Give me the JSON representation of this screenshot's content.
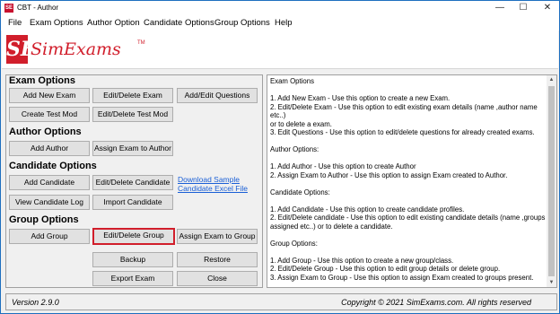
{
  "window": {
    "title": "CBT - Author",
    "minimize": "—",
    "maximize": "☐",
    "close": "✕"
  },
  "menu": [
    "File",
    "Exam Options",
    "Author Option",
    "Candidate Options",
    "Group Options",
    "Help"
  ],
  "logo": {
    "mark": "SE",
    "text": "SimExams",
    "tm": "TM"
  },
  "sections": {
    "exam": {
      "title": "Exam Options",
      "add_new_exam": "Add New Exam",
      "edit_delete_exam": "Edit/Delete Exam",
      "add_edit_questions": "Add/Edit Questions",
      "create_test_mod": "Create Test Mod",
      "edit_delete_test_mod": "Edit/Delete Test Mod"
    },
    "author": {
      "title": "Author Options",
      "add_author": "Add Author",
      "assign_exam_to_author": "Assign Exam to Author"
    },
    "candidate": {
      "title": "Candidate Options",
      "add_candidate": "Add Candidate",
      "edit_delete_candidate": "Edit/Delete Candidate",
      "download_link_1": "Download Sample",
      "download_link_2": "Candidate Excel File",
      "view_candidate_log": "View Candidate Log",
      "import_candidate": "Import Candidate"
    },
    "group": {
      "title": "Group Options",
      "add_group": "Add Group",
      "edit_delete_group": "Edit/Delete Group",
      "assign_exam_to_group": "Assign Exam to Group"
    },
    "misc": {
      "backup": "Backup",
      "restore": "Restore",
      "export_exam": "Export Exam",
      "close": "Close"
    }
  },
  "help_text": "Exam Options\n\n1. Add New Exam - Use this option to create a new Exam.\n2. Edit/Delete Exam - Use this option to edit existing exam details (name ,author name etc..)\nor to delete a exam.\n3. Edit Questions - Use this option to edit/delete questions for already created exams.\n\nAuthor Options:\n\n1. Add Author - Use this option to create Author\n2. Assign Exam to Author - Use this option to assign Exam created to Author.\n\nCandidate Options:\n\n1. Add Candidate - Use this option to create candidate profiles.\n2. Edit/Delete candidate - Use this option to edit existing candidate details (name ,groups\nassigned etc..) or to delete a candidate.\n\nGroup Options:\n\n1. Add Group - Use this option to create a new group/class.\n2. Edit/Delete Group - Use this option to edit group details or delete group.\n3. Assign Exam to Group - Use this option to assign Exam created to groups present.\n\nExport - Use this option to export the created exam database to a known location which\ncan later be imported and used in CBT Software- Exam Engine.",
  "status": {
    "version": "Version 2.9.0",
    "copyright": "Copyright © 2021 SimExams.com. All rights reserved"
  },
  "colors": {
    "brand": "#d11e2b",
    "link": "#1a5fd6",
    "window_border": "#1e6fbf"
  }
}
